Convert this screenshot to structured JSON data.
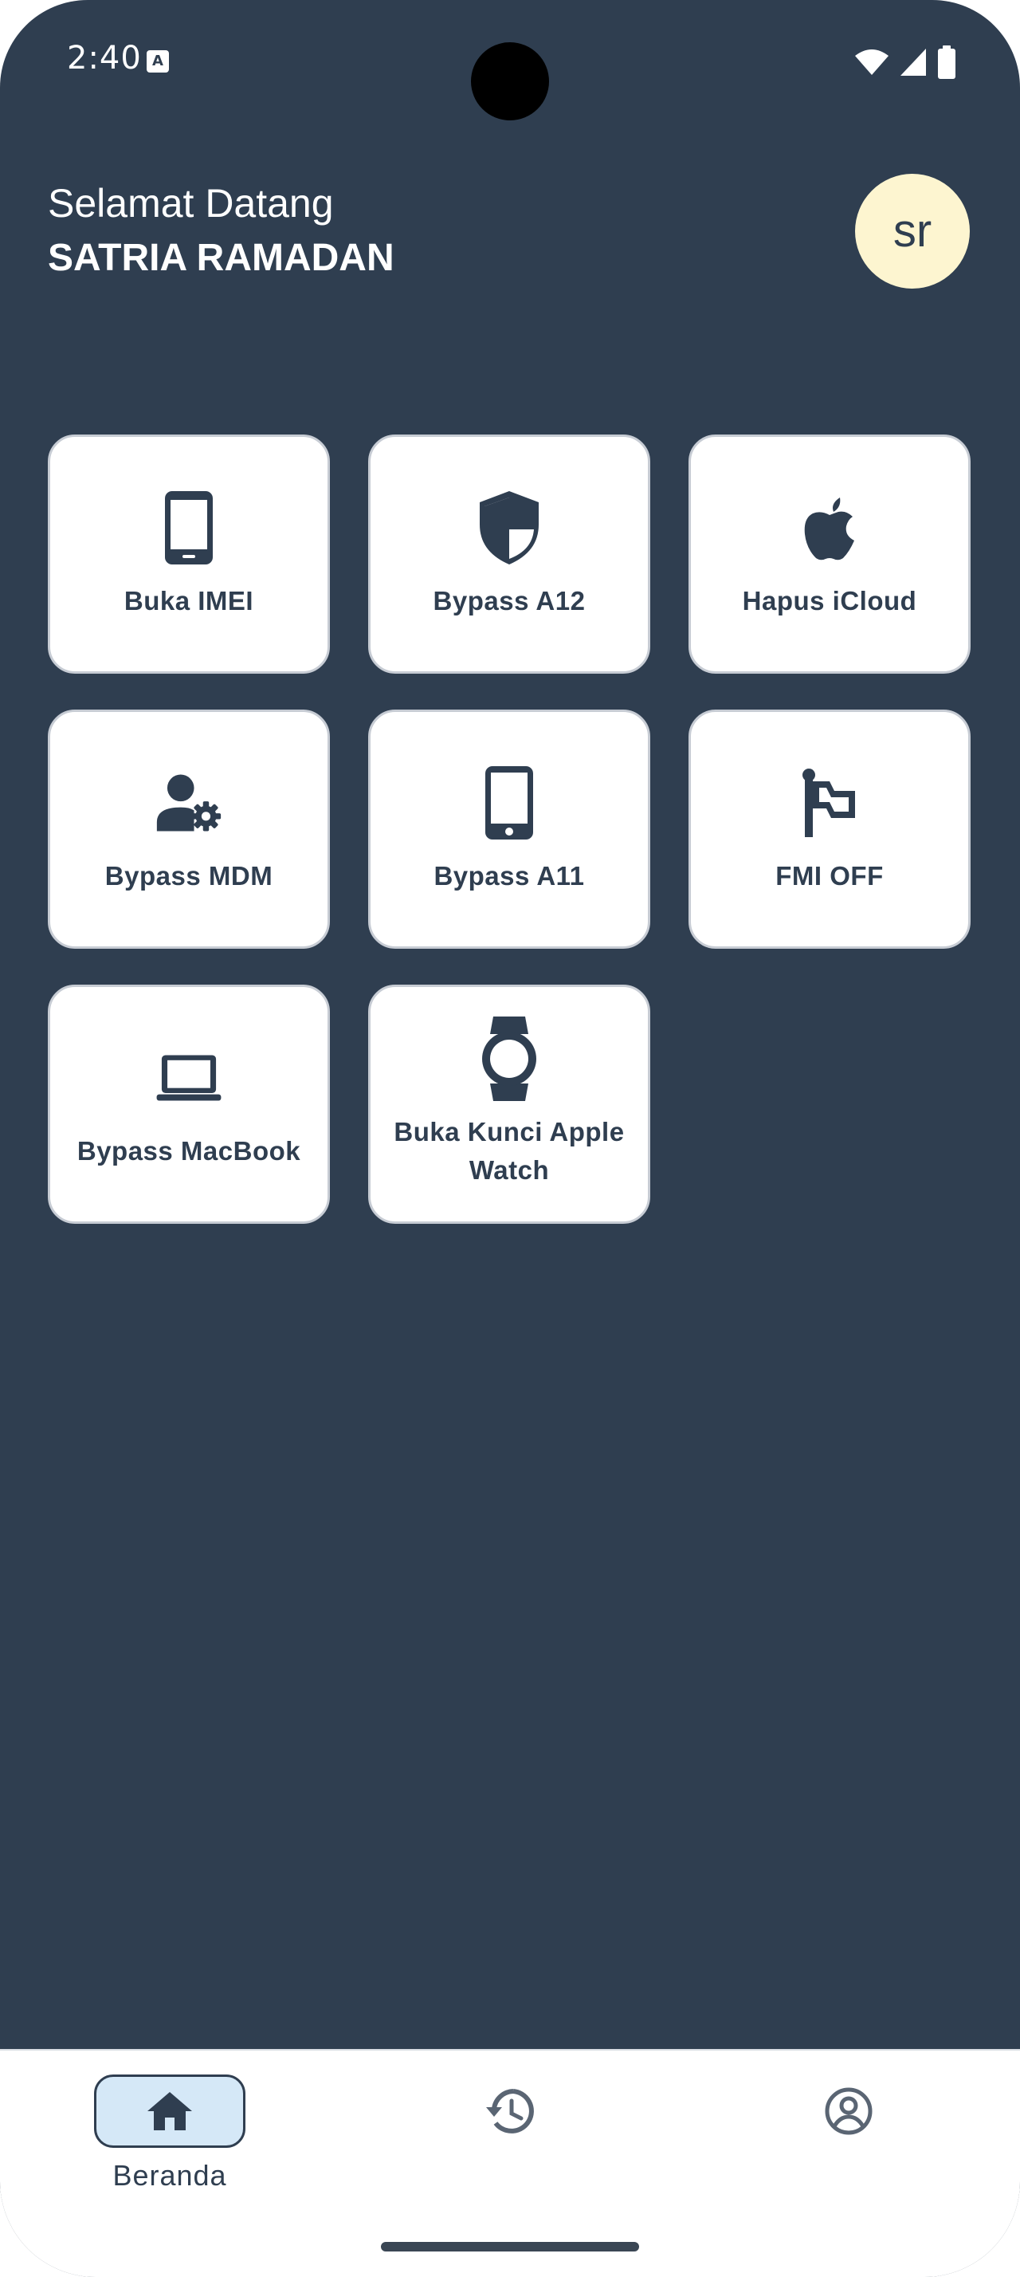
{
  "status_bar": {
    "time": "2:40",
    "notification_icon": "A",
    "icons": [
      "wifi-icon",
      "signal-icon",
      "battery-icon"
    ]
  },
  "header": {
    "greeting": "Selamat Datang",
    "user_name": "SATRIA RAMADAN",
    "avatar_initials": "sr"
  },
  "menu": [
    {
      "label": "Buka IMEI",
      "icon": "smartphone-icon"
    },
    {
      "label": "Bypass A12",
      "icon": "shield-icon"
    },
    {
      "label": "Hapus iCloud",
      "icon": "apple-icon"
    },
    {
      "label": "Bypass MDM",
      "icon": "user-gear-icon"
    },
    {
      "label": "Bypass A11",
      "icon": "smartphone-icon"
    },
    {
      "label": "FMI OFF",
      "icon": "flag-icon"
    },
    {
      "label": "Bypass MacBook",
      "icon": "laptop-icon"
    },
    {
      "label": "Buka Kunci Apple Watch",
      "icon": "watch-icon"
    }
  ],
  "bottom_nav": {
    "items": [
      {
        "label": "Beranda",
        "icon": "home-icon",
        "active": true
      },
      {
        "label": "",
        "icon": "history-icon",
        "active": false
      },
      {
        "label": "",
        "icon": "account-icon",
        "active": false
      }
    ]
  },
  "colors": {
    "background": "#2f3e50",
    "card": "#ffffff",
    "avatar_bg": "#fdf5d0",
    "active_nav": "#d5e8f7"
  }
}
